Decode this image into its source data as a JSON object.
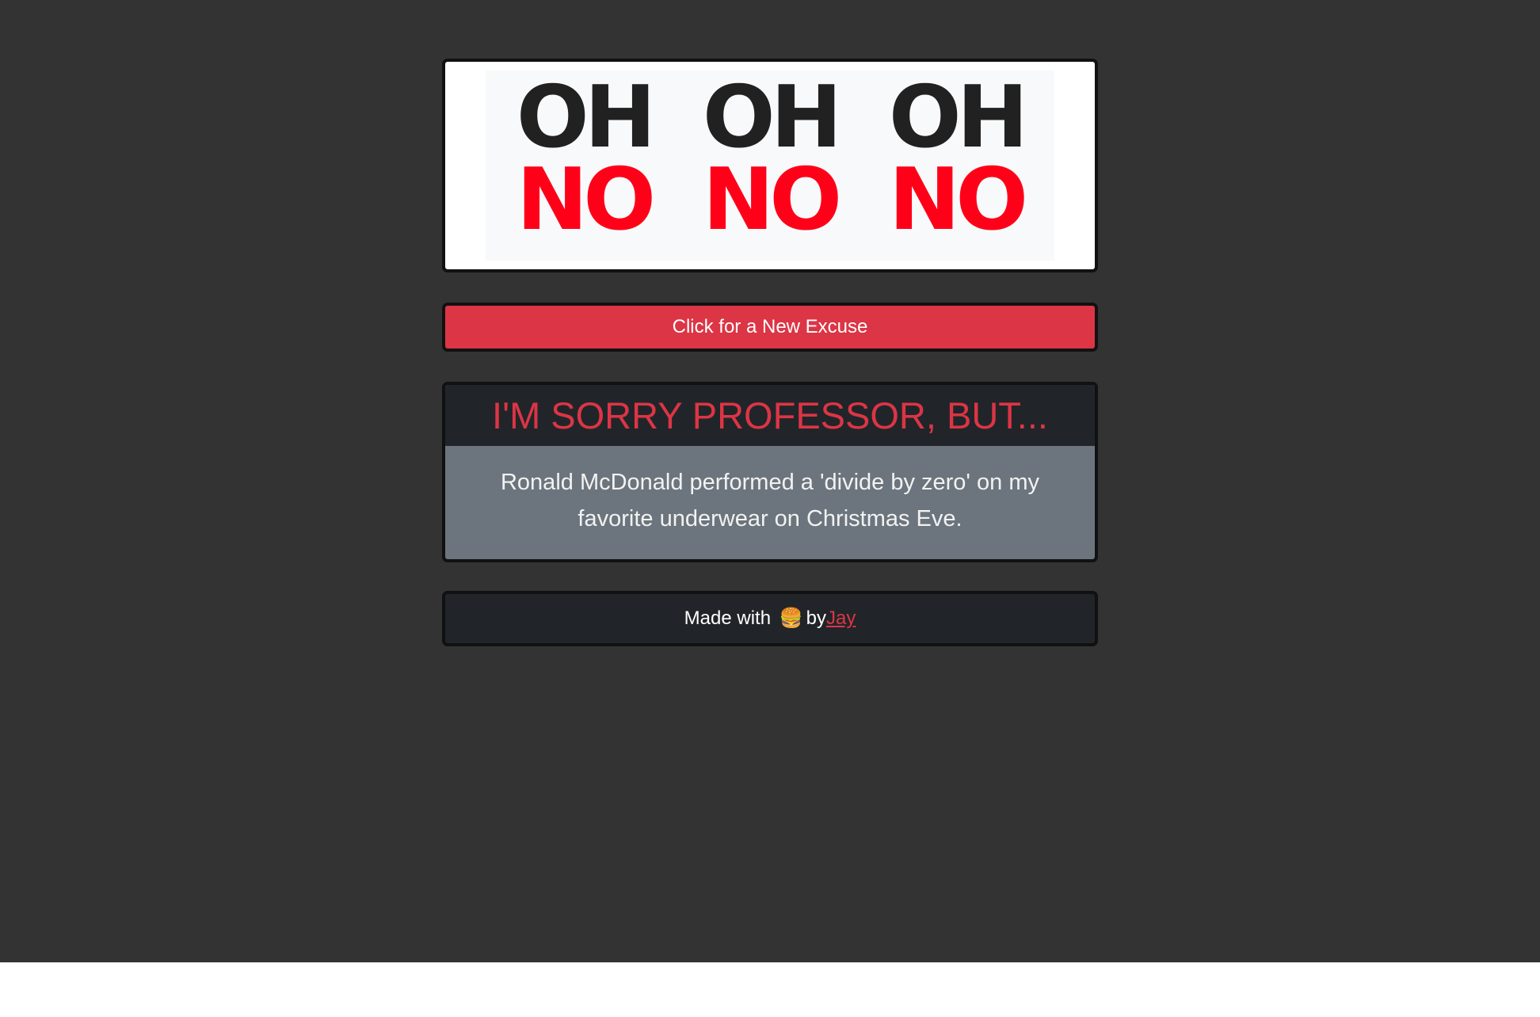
{
  "logo": {
    "line1": [
      "OH",
      "OH",
      "OH"
    ],
    "line2": [
      "NO",
      "NO",
      "NO"
    ],
    "colors": {
      "oh": "#212121",
      "no": "#ff0019"
    }
  },
  "actions": {
    "new_excuse_label": "Click for a New Excuse",
    "button_color": "#dc3545"
  },
  "excuse": {
    "heading": "I'M SORRY PROFESSOR, BUT...",
    "text": "Ronald McDonald performed a 'divide by zero' on my favorite underwear on Christmas Eve."
  },
  "footer": {
    "made_with": "Made with",
    "emoji": "🍔",
    "by": "by",
    "author": "Jay",
    "emoji_icon": "hamburger-icon"
  },
  "colors": {
    "page_bg": "#333333",
    "accent": "#dc3545",
    "dark_panel": "#212529",
    "gray_panel": "#6c757d"
  }
}
